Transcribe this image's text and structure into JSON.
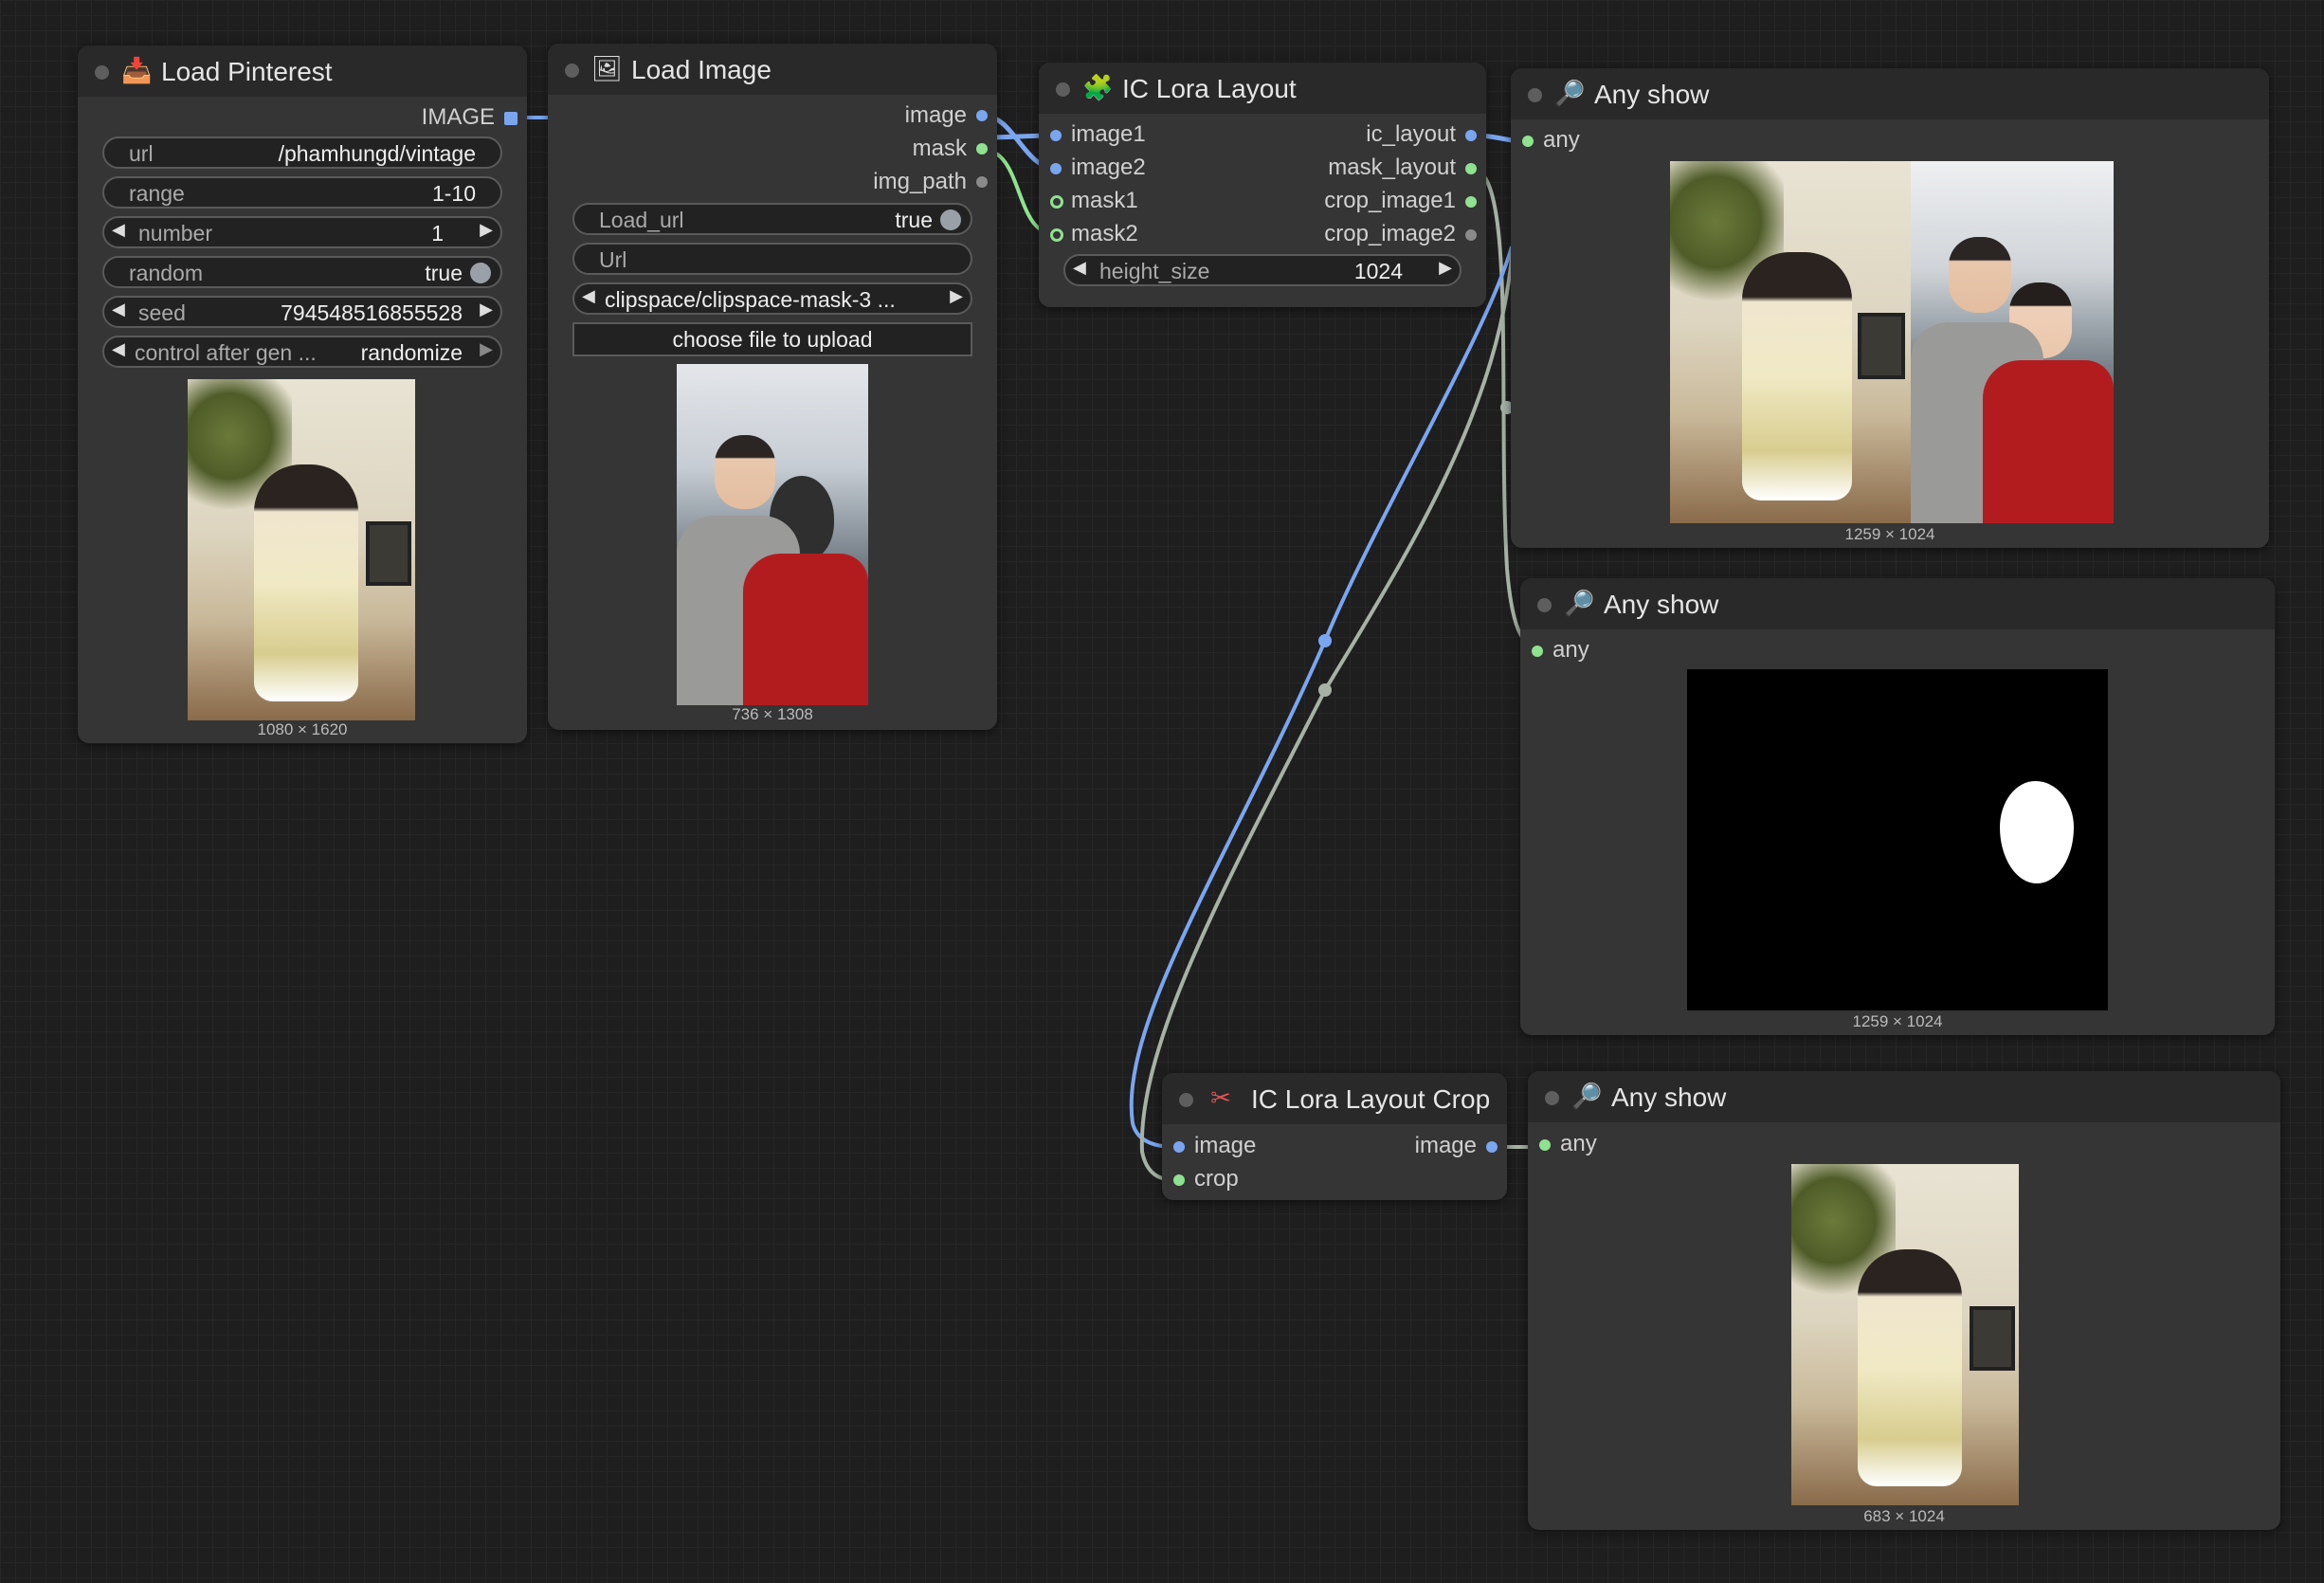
{
  "nodes": {
    "load_pinterest": {
      "title": "Load Pinterest",
      "output_label": "IMAGE",
      "widgets": {
        "url": {
          "label": "url",
          "value": "/phamhungd/vintage"
        },
        "range": {
          "label": "range",
          "value": "1-10"
        },
        "number": {
          "label": "number",
          "value": "1"
        },
        "random": {
          "label": "random",
          "value": "true"
        },
        "seed": {
          "label": "seed",
          "value": "794548516855528"
        },
        "control": {
          "label": "control after gen ...",
          "value": "randomize"
        }
      },
      "preview_caption": "1080 × 1620"
    },
    "load_image": {
      "title": "Load Image",
      "outputs": {
        "image": "image",
        "mask": "mask",
        "img_path": "img_path"
      },
      "widgets": {
        "load_url": {
          "label": "Load_url",
          "value": "true"
        },
        "url_field": {
          "label": "Url"
        },
        "file": {
          "value": "clipspace/clipspace-mask-3 ..."
        },
        "upload_button": "choose file to upload"
      },
      "preview_caption": "736 × 1308"
    },
    "ic_lora_layout": {
      "title": "IC Lora Layout",
      "inputs": {
        "image1": "image1",
        "image2": "image2",
        "mask1": "mask1",
        "mask2": "mask2"
      },
      "outputs": {
        "ic_layout": "ic_layout",
        "mask_layout": "mask_layout",
        "crop_image1": "crop_image1",
        "crop_image2": "crop_image2"
      },
      "widgets": {
        "height_size": {
          "label": "height_size",
          "value": "1024"
        }
      }
    },
    "any_show_1": {
      "title": "Any show",
      "input": "any",
      "preview_caption": "1259 × 1024"
    },
    "any_show_2": {
      "title": "Any show",
      "input": "any",
      "preview_caption": "1259 × 1024"
    },
    "ic_lora_layout_crop": {
      "title": "IC Lora Layout Crop",
      "inputs": {
        "image": "image",
        "crop": "crop"
      },
      "outputs": {
        "image": "image"
      }
    },
    "any_show_3": {
      "title": "Any show",
      "input": "any",
      "preview_caption": "683 × 1024"
    }
  },
  "icons": {
    "load_pinterest": "inbox-tray-icon",
    "load_image": "picture-icon",
    "ic_lora_layout": "puzzle-icon",
    "any_show": "magnifier-icon",
    "ic_lora_layout_crop": "scissors-icon"
  },
  "colors": {
    "canvas_bg": "#1e1e1e",
    "node_bg": "#353535",
    "node_header": "#292929",
    "image_wire": "#7aa6f0",
    "mask_wire": "#8fe28f",
    "generic_wire": "#a6b2a6"
  }
}
